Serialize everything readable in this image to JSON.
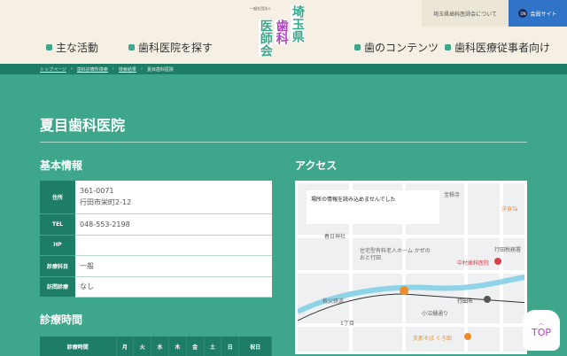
{
  "header": {
    "logo": {
      "sub": "一般社団法人",
      "col1": "医師会",
      "col2": "歯科",
      "col3": "埼玉県"
    },
    "nav": [
      "主な活動",
      "歯科医院を探す",
      "歯のコンテンツ",
      "歯科医療従事者向け"
    ],
    "about": "埼玉県歯科医師会について",
    "member": "会員サイト",
    "member_icon": "DN"
  },
  "breadcrumb": [
    "トップページ",
    "歯科診療所検索",
    "検索結果",
    "夏目歯科医院"
  ],
  "title": "夏目歯科医院",
  "basic": {
    "heading": "基本情報",
    "rows": [
      {
        "label": "住所",
        "value1": "361-0071",
        "value2": "行田市栄町2-12"
      },
      {
        "label": "TEL",
        "value": "048-553-2198"
      },
      {
        "label": "HP",
        "value": ""
      },
      {
        "label": "診療科目",
        "value": "一般"
      },
      {
        "label": "訪問診療",
        "value": "なし"
      }
    ]
  },
  "hours": {
    "heading": "診療時間",
    "cols": [
      "診療時間",
      "月",
      "火",
      "水",
      "木",
      "金",
      "土",
      "日",
      "祝日"
    ]
  },
  "access": {
    "heading": "アクセス",
    "map_error": "場所の情報を読み込めませんでした",
    "labels": [
      "宝積寺",
      "春日神社",
      "住宅型有料老人ホーム かぜのおと行田",
      "中村歯科医院",
      "行田税務署",
      "行田市",
      "小沼樋通り",
      "1丁目",
      "支那そば くろ田",
      "秩父鉄道",
      "洋食Ta"
    ]
  },
  "top_button": "TOP"
}
